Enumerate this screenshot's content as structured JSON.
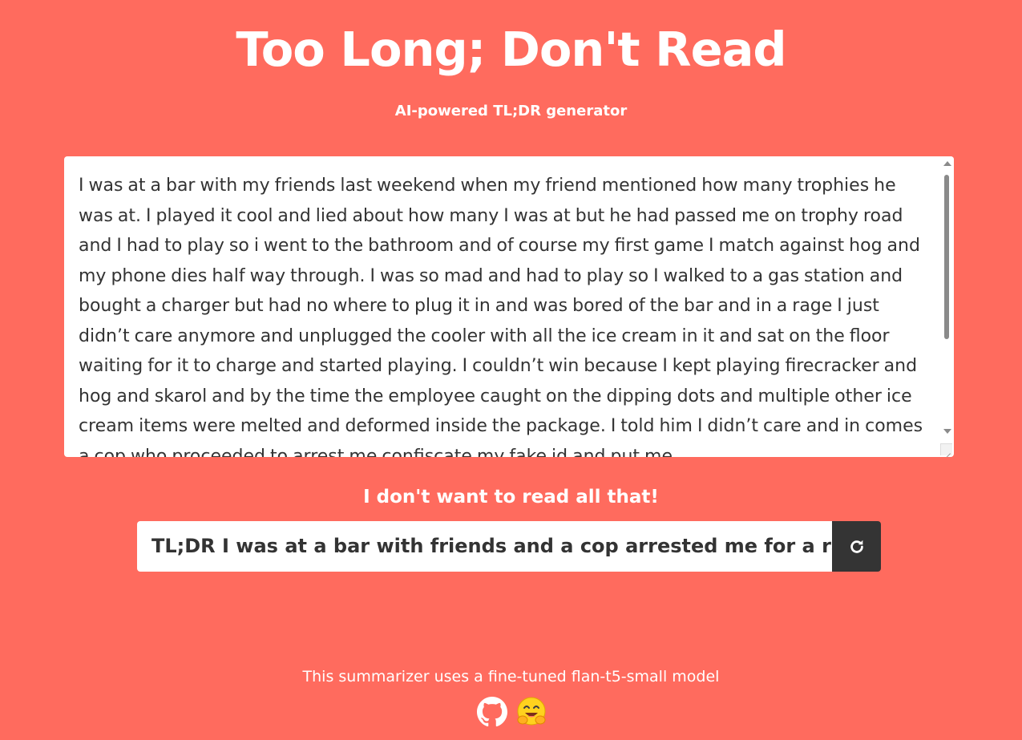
{
  "header": {
    "title": "Too Long; Don't Read",
    "subtitle": "AI-powered TL;DR generator"
  },
  "input": {
    "text": " I was at a bar with my friends last weekend when my friend mentioned how many trophies he was at. I played it cool and lied about how many I was at but he had passed me on trophy road and I had to play so i went to the bathroom and of course my first game I match against hog and my phone dies half way through. I was so mad and had to play so I walked to a gas station and bought a charger but had no where to plug it in and was bored of the bar and in a rage I just didn’t care anymore and unplugged the cooler with all the ice cream in it and sat on the floor waiting for it to charge and started playing. I couldn’t win because I kept playing firecracker and hog and skarol and by the time the employee caught on the dipping dots and multiple other ice cream items were melted and deformed inside the package. I told him I didn’t care and in comes a cop who proceeded to arrest me confiscate my fake id and put me"
  },
  "action": {
    "label": "I don't want to read all that!",
    "result": "TL;DR I was at a bar with friends and a cop arrested me for a rage",
    "regenerate_icon": "refresh-icon"
  },
  "footer": {
    "text": "This summarizer uses a fine-tuned flan-t5-small model",
    "icons": [
      "github-icon",
      "hugging-face-icon"
    ]
  },
  "colors": {
    "background": "#ff6b5e",
    "button": "#343434",
    "text_dark": "#333333"
  }
}
